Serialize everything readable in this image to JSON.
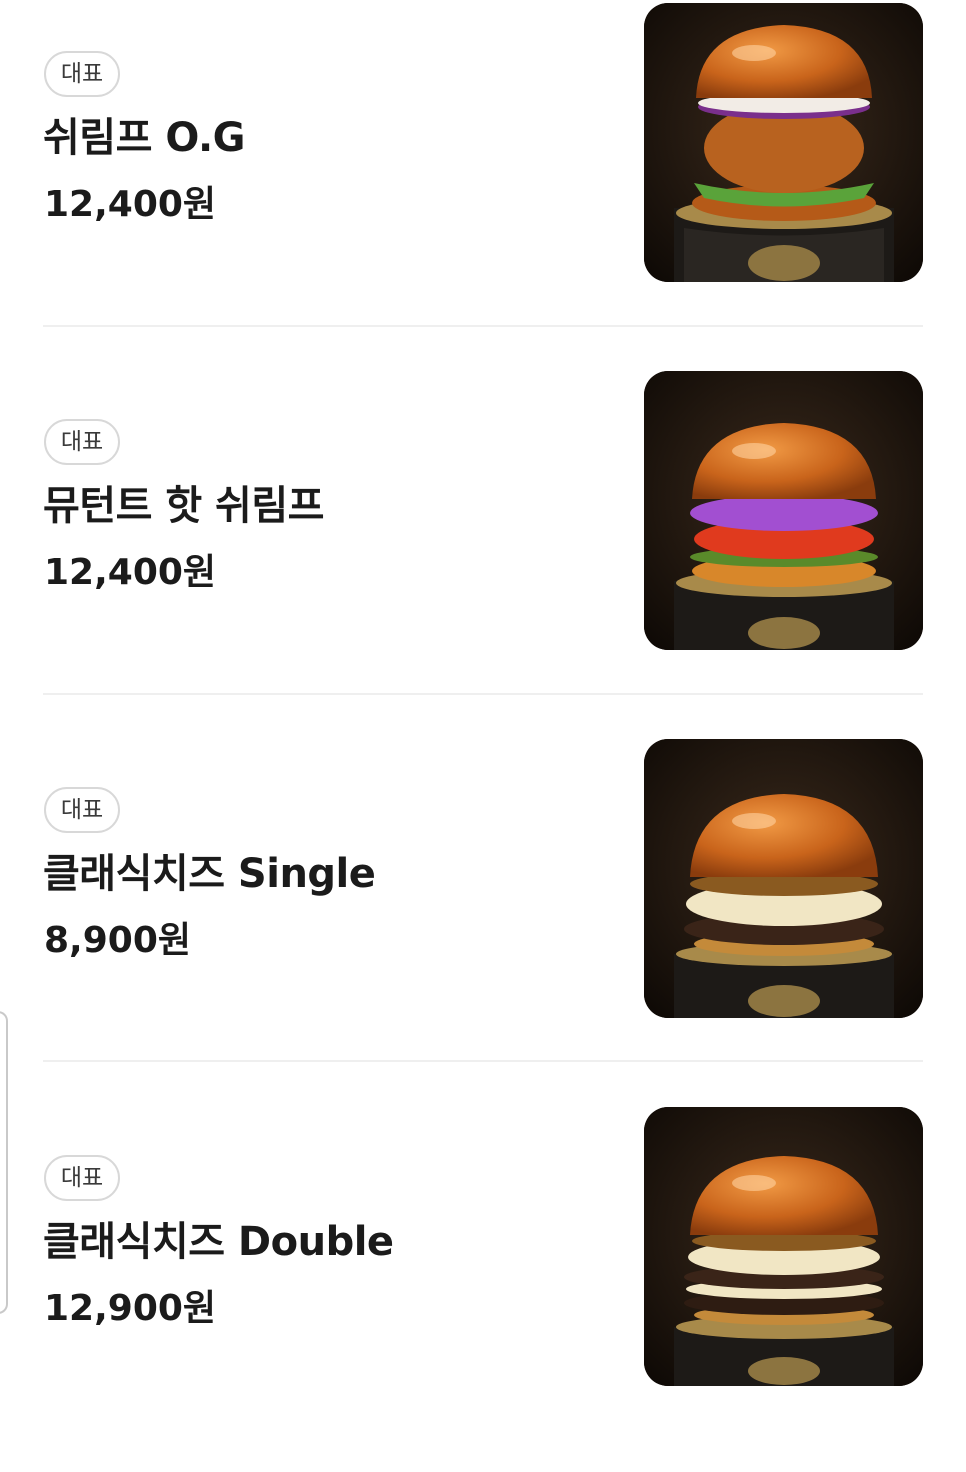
{
  "menu": {
    "items": [
      {
        "badge": "대표",
        "name": "쉬림프 O.G",
        "price": "12,400원",
        "image": "shrimp-og-burger-image",
        "filling_color": "#c7641c",
        "sauce_color": "#7a2f8c"
      },
      {
        "badge": "대표",
        "name": "뮤턴트 핫 쉬림프",
        "price": "12,400원",
        "image": "mutant-hot-shrimp-burger-image",
        "filling_color": "#e03a1e",
        "sauce_color": "#a24fd1"
      },
      {
        "badge": "대표",
        "name": "클래식치즈 Single",
        "price": "8,900원",
        "image": "classic-cheese-single-burger-image",
        "filling_color": "#3a2418",
        "sauce_color": "#f1e6c4"
      },
      {
        "badge": "대표",
        "name": "클래식치즈 Double",
        "price": "12,900원",
        "image": "classic-cheese-double-burger-image",
        "filling_color": "#3a2418",
        "sauce_color": "#f1e6c4"
      }
    ]
  },
  "colors": {
    "bun": "#c96a1c",
    "background_dark": "#1a120c",
    "divider": "#efefef",
    "badge_border": "#d8d8d8"
  }
}
